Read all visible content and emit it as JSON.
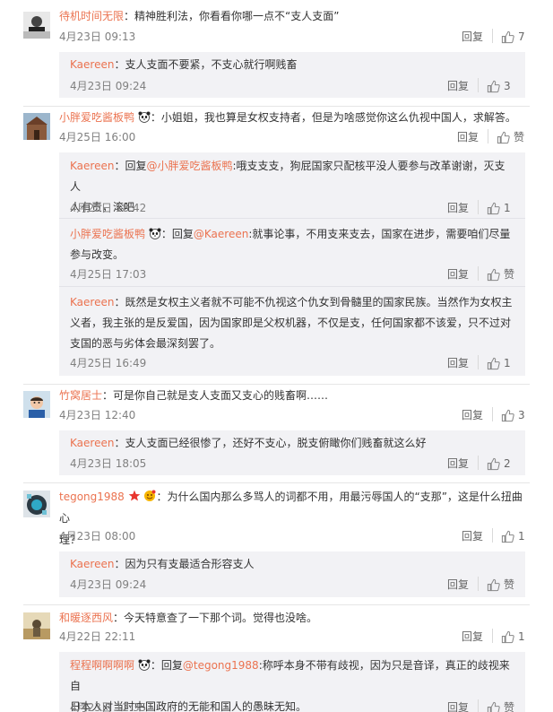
{
  "reply_label": "回复",
  "like_label": "赞",
  "colors": {
    "accent": "#eb7350",
    "sub_bg": "#f2f2f5"
  },
  "comments": [
    {
      "user": "待机时间无限",
      "sep": "：",
      "text": "精神胜利法，你看看你哪一点不“支人支面”",
      "time": "4月23日 09:13",
      "likes": "7",
      "replies": [
        {
          "user": "Kaereen",
          "sep": "：",
          "text": "支人支面不要紧，不支心就行啊贱畜",
          "time": "4月23日 09:24",
          "likes": "3"
        }
      ]
    },
    {
      "user": "小胖爱吃酱板鸭",
      "sep": "：",
      "text": "小姐姐，我也算是女权支持者，但是为啥感觉你这么仇视中国人，求解答。",
      "time": "4月25日 16:00",
      "likes": "赞",
      "replies": [
        {
          "user": "Kaereen",
          "sep": "：",
          "pre": "回复",
          "at": "@小胖爱吃酱板鸭",
          "text": ":哦支支支，狗屁国家只配核平没人要参与改革谢谢，灭支人",
          "text2": "人有责，滚吧",
          "time": "4月25日 18:42",
          "likes": "1"
        },
        {
          "user": "小胖爱吃酱板鸭",
          "sep": "：",
          "pre": "回复",
          "at": "@Kaereen",
          "text": ":就事论事，不用支来支去，国家在进步，需要咱们尽量",
          "text2": "参与改变。",
          "time": "4月25日 17:03",
          "likes": "赞"
        },
        {
          "user": "Kaereen",
          "sep": "：",
          "text": "既然是女权主义者就不可能不仇视这个仇女到骨髓里的国家民族。当然作为女权主",
          "text2": "义者，我主张的是反爱国，因为国家即是父权机器，不仅是支，任何国家都不该爱，只不过对",
          "text3": "支国的恶与劣体会最深刻罢了。",
          "time": "4月25日 16:49",
          "likes": "1"
        }
      ]
    },
    {
      "user": "竹窝居士",
      "sep": "：",
      "text": "可是你自己就是支人支面又支心的贱畜啊……",
      "time": "4月23日 12:40",
      "likes": "3",
      "replies": [
        {
          "user": "Kaereen",
          "sep": "：",
          "text": "支人支面已经很惨了，还好不支心，脱支俯瞰你们贱畜就这么好",
          "time": "4月23日 18:05",
          "likes": "2"
        }
      ]
    },
    {
      "user": "tegong1988",
      "sep": "：",
      "text": "为什么国内那么多骂人的词都不用，用最污辱国人的“支那”，这是什么扭曲心",
      "text2": "理？",
      "time": "4月23日 08:00",
      "likes": "1",
      "replies": [
        {
          "user": "Kaereen",
          "sep": "：",
          "text": "因为只有支最适合形容支人",
          "time": "4月23日 09:24",
          "likes": "赞"
        }
      ]
    },
    {
      "user": "和暖逐西风",
      "sep": "：",
      "text": "今天特意查了一下那个词。觉得也没啥。",
      "time": "4月22日 22:11",
      "likes": "1",
      "replies": [
        {
          "user": "程程啊啊啊啊",
          "sep": "：",
          "pre": "回复",
          "at": "@tegong1988",
          "text": ":称呼本身不带有歧视，因为只是音译，真正的歧视来自",
          "text2": "日本人对当时中国政府的无能和国人的愚昧无知。",
          "time": "4月23日 12:35",
          "likes": "赞"
        }
      ]
    }
  ]
}
